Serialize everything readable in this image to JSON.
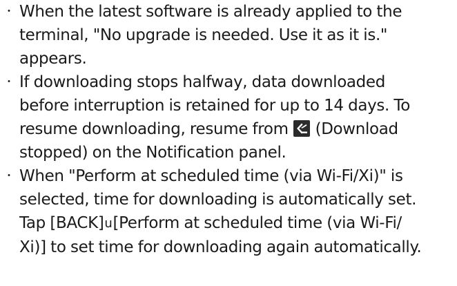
{
  "notes": [
    {
      "lines": [
        "When the latest software is already applied to the",
        "terminal, \"No upgrade is needed. Use it as it is.\"",
        "appears."
      ]
    },
    {
      "lines": [
        "If downloading stops halfway, data downloaded",
        "before interruption is retained for up to 14 days. To",
        "resume downloading, resume from",
        "(Download",
        "stopped) on the Notification panel."
      ],
      "icon": "download-stopped-icon"
    },
    {
      "lines": [
        "When \"Perform at scheduled time (via Wi-Fi/Xi)\" is",
        "selected, time for downloading is automatically set.",
        "Tap [BACK]",
        "u",
        "[Perform at scheduled time (via Wi-Fi/",
        "Xi)] to set time for downloading again automatically."
      ]
    }
  ],
  "bullet": "・"
}
